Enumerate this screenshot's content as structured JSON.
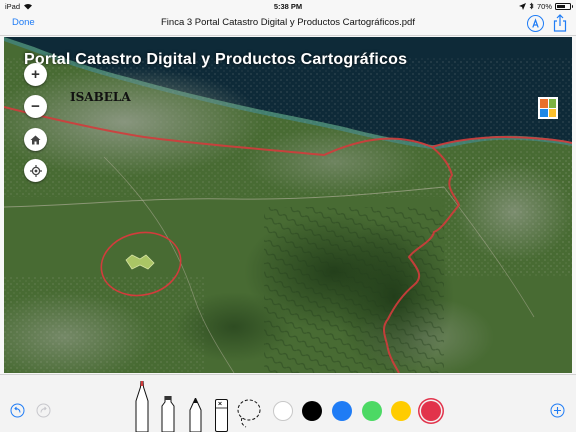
{
  "status_bar": {
    "device": "iPad",
    "time": "5:38 PM",
    "battery": "70%",
    "battery_level": 0.7
  },
  "nav": {
    "done_label": "Done",
    "document_title": "Finca 3 Portal Catastro Digital y Productos Cartográficos.pdf",
    "markup_icon": "markup-pen-icon",
    "share_icon": "share-icon"
  },
  "map": {
    "portal_title": "Portal Catastro Digital y Productos Cartográficos",
    "place_label": "ISABELA",
    "controls": [
      {
        "name": "zoom-in",
        "icon": "plus-icon",
        "symbol": "+"
      },
      {
        "name": "zoom-out",
        "icon": "minus-icon",
        "symbol": "−"
      },
      {
        "name": "home",
        "icon": "home-icon"
      },
      {
        "name": "locate",
        "icon": "locate-icon"
      }
    ],
    "logo_icon": "agency-logo-icon"
  },
  "toolbar": {
    "tools": [
      "undo-icon",
      "redo-icon",
      "pen-tool-icon",
      "marker-tool-icon",
      "pencil-tool-icon",
      "eraser-tool-icon",
      "lasso-tool-icon",
      "add-icon"
    ],
    "colors": [
      {
        "name": "white",
        "hex": "#ffffff"
      },
      {
        "name": "black",
        "hex": "#000000"
      },
      {
        "name": "blue",
        "hex": "#1f7cf5"
      },
      {
        "name": "green",
        "hex": "#4cd964"
      },
      {
        "name": "yellow",
        "hex": "#ffcc00"
      },
      {
        "name": "red",
        "hex": "#e2334b"
      }
    ],
    "selected_color": "red"
  },
  "colors": {
    "accent": "#1f7cf5",
    "annotation_red": "#d23c3c"
  }
}
